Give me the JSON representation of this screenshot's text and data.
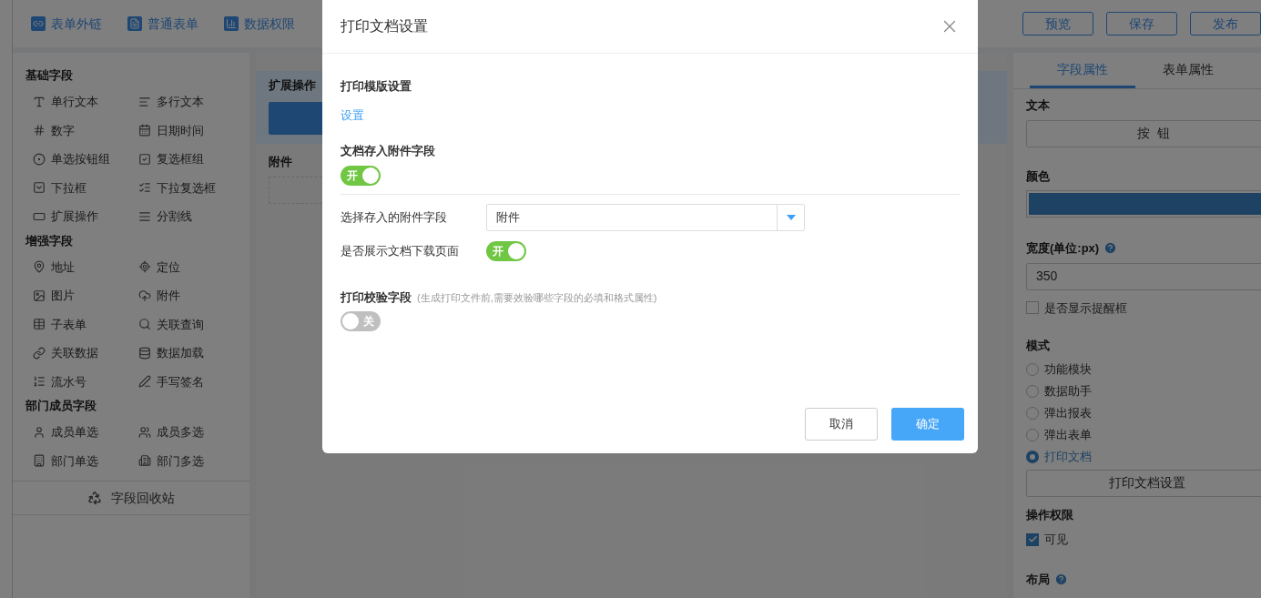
{
  "top_links": [
    {
      "label": "表单外链"
    },
    {
      "label": "普通表单"
    },
    {
      "label": "数据权限"
    }
  ],
  "top_buttons": [
    {
      "label": "预览"
    },
    {
      "label": "保存"
    },
    {
      "label": "发布"
    }
  ],
  "field_groups": [
    {
      "title": "基础字段",
      "items": [
        "单行文本",
        "多行文本",
        "数字",
        "日期时间",
        "单选按钮组",
        "复选框组",
        "下拉框",
        "下拉复选框",
        "扩展操作",
        "分割线"
      ]
    },
    {
      "title": "增强字段",
      "items": [
        "地址",
        "定位",
        "图片",
        "附件",
        "子表单",
        "关联查询",
        "关联数据",
        "数据加载",
        "流水号",
        "手写签名"
      ]
    },
    {
      "title": "部门成员字段",
      "items": [
        "成员单选",
        "成员多选",
        "部门单选",
        "部门多选"
      ]
    }
  ],
  "recycle_bin": "字段回收站",
  "canvas": {
    "section_title": "扩展操作",
    "attachment_label": "附件"
  },
  "properties": {
    "tabs": [
      {
        "label": "字段属性",
        "selected": true
      },
      {
        "label": "表单属性",
        "selected": false
      }
    ],
    "text_label": "文本",
    "button_text": "按  钮",
    "color_label": "颜色",
    "width_label": "宽度(单位:px)",
    "width_value": "350",
    "reminder": {
      "label": "是否显示提醒框",
      "checked": false
    },
    "mode_label": "模式",
    "modes": [
      {
        "label": "功能模块",
        "selected": false
      },
      {
        "label": "数据助手",
        "selected": false
      },
      {
        "label": "弹出报表",
        "selected": false
      },
      {
        "label": "弹出表单",
        "selected": false
      },
      {
        "label": "打印文档",
        "selected": true
      }
    ],
    "print_settings_button": "打印文档设置",
    "permissions_label": "操作权限",
    "visible": {
      "label": "可见",
      "checked": true
    },
    "layout_label": "布局"
  },
  "dialog": {
    "title": "打印文档设置",
    "template_label": "打印模版设置",
    "template_link": "设置",
    "store_label": "文档存入附件字段",
    "store_switch": {
      "on": true,
      "text": "开"
    },
    "select_label": "选择存入的附件字段",
    "select_value": "附件",
    "download_label": "是否展示文档下载页面",
    "download_switch": {
      "on": true,
      "text": "开"
    },
    "verify_label": "打印校验字段",
    "verify_hint": "(生成打印文件前,需要效验哪些字段的必填和格式属性)",
    "verify_switch": {
      "on": false,
      "text": "关"
    },
    "buttons": [
      {
        "label": "取消",
        "kind": "secondary"
      },
      {
        "label": "确定",
        "kind": "primary"
      }
    ]
  }
}
